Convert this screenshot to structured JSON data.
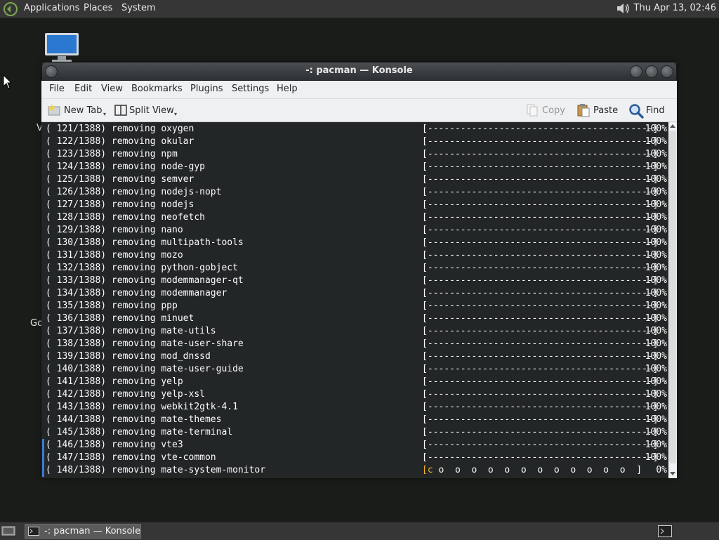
{
  "top_panel": {
    "menus": [
      "Applications",
      "Places",
      "System"
    ],
    "clock": "Thu Apr 13, 02:46"
  },
  "desktop": {
    "fragments": [
      "V",
      "Go"
    ]
  },
  "window": {
    "title": "-: pacman — Konsole",
    "menu": [
      "File",
      "Edit",
      "View",
      "Bookmarks",
      "Plugins",
      "Settings",
      "Help"
    ],
    "toolbar": {
      "new_tab": "New Tab",
      "split_view": "Split View",
      "copy": "Copy",
      "paste": "Paste",
      "find": "Find"
    }
  },
  "terminal": {
    "done_bar": "[-----------------------------------------]",
    "lines": [
      {
        "text": "( 121/1388) removing oxygen",
        "pct": "100%"
      },
      {
        "text": "( 122/1388) removing okular",
        "pct": "100%"
      },
      {
        "text": "( 123/1388) removing npm",
        "pct": "100%"
      },
      {
        "text": "( 124/1388) removing node-gyp",
        "pct": "100%"
      },
      {
        "text": "( 125/1388) removing semver",
        "pct": "100%"
      },
      {
        "text": "( 126/1388) removing nodejs-nopt",
        "pct": "100%"
      },
      {
        "text": "( 127/1388) removing nodejs",
        "pct": "100%"
      },
      {
        "text": "( 128/1388) removing neofetch",
        "pct": "100%"
      },
      {
        "text": "( 129/1388) removing nano",
        "pct": "100%"
      },
      {
        "text": "( 130/1388) removing multipath-tools",
        "pct": "100%"
      },
      {
        "text": "( 131/1388) removing mozo",
        "pct": "100%"
      },
      {
        "text": "( 132/1388) removing python-gobject",
        "pct": "100%"
      },
      {
        "text": "( 133/1388) removing modemmanager-qt",
        "pct": "100%"
      },
      {
        "text": "( 134/1388) removing modemmanager",
        "pct": "100%"
      },
      {
        "text": "( 135/1388) removing ppp",
        "pct": "100%"
      },
      {
        "text": "( 136/1388) removing minuet",
        "pct": "100%"
      },
      {
        "text": "( 137/1388) removing mate-utils",
        "pct": "100%"
      },
      {
        "text": "( 138/1388) removing mate-user-share",
        "pct": "100%"
      },
      {
        "text": "( 139/1388) removing mod_dnssd",
        "pct": "100%"
      },
      {
        "text": "( 140/1388) removing mate-user-guide",
        "pct": "100%"
      },
      {
        "text": "( 141/1388) removing yelp",
        "pct": "100%"
      },
      {
        "text": "( 142/1388) removing yelp-xsl",
        "pct": "100%"
      },
      {
        "text": "( 143/1388) removing webkit2gtk-4.1",
        "pct": "100%"
      },
      {
        "text": "( 144/1388) removing mate-themes",
        "pct": "100%"
      },
      {
        "text": "( 145/1388) removing mate-terminal",
        "pct": "100%"
      },
      {
        "text": "( 146/1388) removing vte3",
        "pct": "100%"
      },
      {
        "text": "( 147/1388) removing vte-common",
        "pct": "100%"
      }
    ],
    "current": {
      "text": "( 148/1388) removing mate-system-monitor",
      "bar_open": "[",
      "pacman": "c",
      "dots": " o  o  o  o  o  o  o  o  o  o  o  o  ",
      "bar_close": "]",
      "pct": "0%"
    }
  },
  "bottom_panel": {
    "task_label": "-: pacman — Konsole"
  },
  "colors": {
    "terminal_bg": "#232627",
    "terminal_fg": "#fcfcfc",
    "panel_bg": "#363636",
    "chrome_bg": "#eff0f1",
    "pacman": "#f0b030"
  }
}
